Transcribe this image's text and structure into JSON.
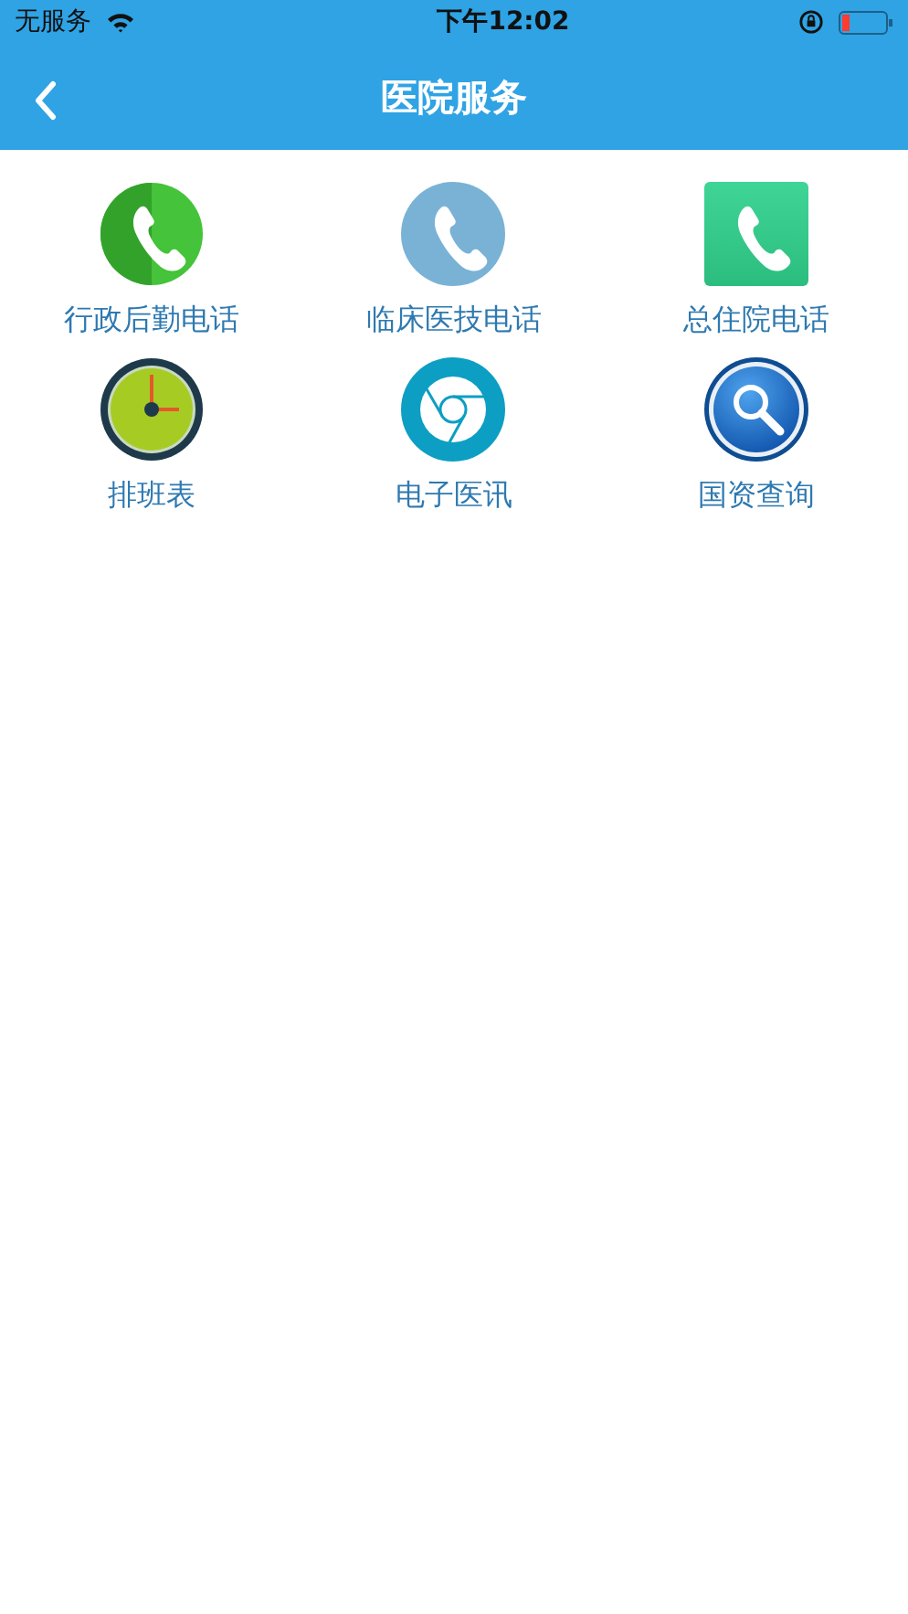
{
  "status_bar": {
    "carrier": "无服务",
    "time": "下午12:02"
  },
  "nav_bar": {
    "title": "医院服务"
  },
  "services": [
    {
      "label": "行政后勤电话"
    },
    {
      "label": "临床医技电话"
    },
    {
      "label": "总住院电话"
    },
    {
      "label": "排班表"
    },
    {
      "label": "电子医讯"
    },
    {
      "label": "国资查询"
    }
  ]
}
